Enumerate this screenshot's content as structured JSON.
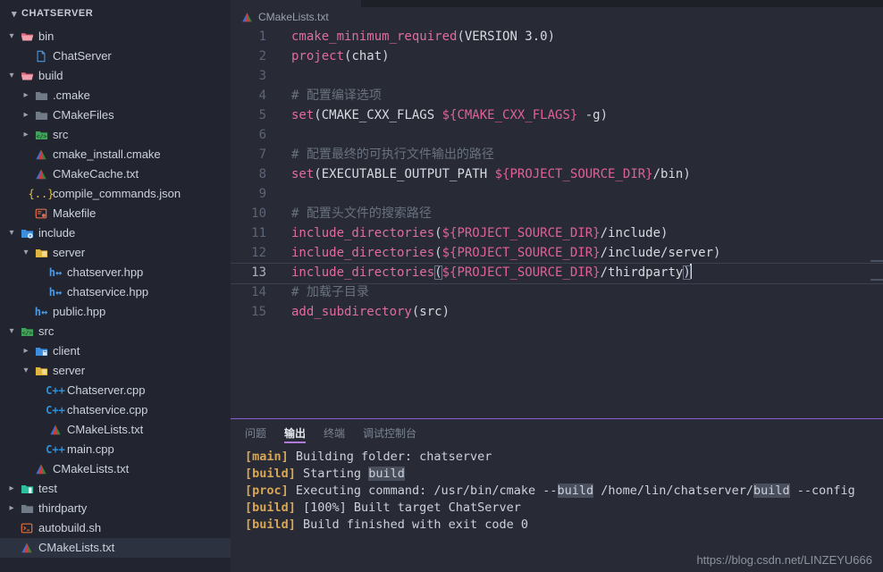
{
  "sidebar": {
    "header": {
      "title": "CHATSERVER",
      "twisty": "chevron-down-icon"
    },
    "items": [
      {
        "label": "bin",
        "indent": 1,
        "twisty": "down",
        "icon": "folder-open-pink",
        "selected": false
      },
      {
        "label": "ChatServer",
        "indent": 2,
        "twisty": "none",
        "icon": "file-blue",
        "selected": false
      },
      {
        "label": "build",
        "indent": 1,
        "twisty": "down",
        "icon": "folder-open-pink",
        "selected": false
      },
      {
        "label": ".cmake",
        "indent": 2,
        "twisty": "right",
        "icon": "folder-grey",
        "selected": false
      },
      {
        "label": "CMakeFiles",
        "indent": 2,
        "twisty": "right",
        "icon": "folder-grey",
        "selected": false
      },
      {
        "label": "src",
        "indent": 2,
        "twisty": "right",
        "icon": "folder-green-code",
        "selected": false
      },
      {
        "label": "cmake_install.cmake",
        "indent": 2,
        "twisty": "none",
        "icon": "cmake-triangle",
        "selected": false
      },
      {
        "label": "CMakeCache.txt",
        "indent": 2,
        "twisty": "none",
        "icon": "cmake-triangle",
        "selected": false
      },
      {
        "label": "compile_commands.json",
        "indent": 2,
        "twisty": "none",
        "icon": "json-braces",
        "selected": false
      },
      {
        "label": "Makefile",
        "indent": 2,
        "twisty": "none",
        "icon": "makefile-red",
        "selected": false
      },
      {
        "label": "include",
        "indent": 1,
        "twisty": "down",
        "icon": "folder-blue-gear",
        "selected": false
      },
      {
        "label": "server",
        "indent": 2,
        "twisty": "down",
        "icon": "folder-yellow",
        "selected": false
      },
      {
        "label": "chatserver.hpp",
        "indent": 3,
        "twisty": "none",
        "icon": "hpp-blue",
        "selected": false
      },
      {
        "label": "chatservice.hpp",
        "indent": 3,
        "twisty": "none",
        "icon": "hpp-blue",
        "selected": false
      },
      {
        "label": "public.hpp",
        "indent": 2,
        "twisty": "none",
        "icon": "hpp-blue",
        "selected": false
      },
      {
        "label": "src",
        "indent": 1,
        "twisty": "down",
        "icon": "folder-green-code",
        "selected": false
      },
      {
        "label": "client",
        "indent": 2,
        "twisty": "right",
        "icon": "folder-blue-win",
        "selected": false
      },
      {
        "label": "server",
        "indent": 2,
        "twisty": "down",
        "icon": "folder-yellow",
        "selected": false
      },
      {
        "label": "Chatserver.cpp",
        "indent": 3,
        "twisty": "none",
        "icon": "cpp-blue",
        "selected": false
      },
      {
        "label": "chatservice.cpp",
        "indent": 3,
        "twisty": "none",
        "icon": "cpp-blue",
        "selected": false
      },
      {
        "label": "CMakeLists.txt",
        "indent": 3,
        "twisty": "none",
        "icon": "cmake-triangle",
        "selected": false
      },
      {
        "label": "main.cpp",
        "indent": 3,
        "twisty": "none",
        "icon": "cpp-blue",
        "selected": false
      },
      {
        "label": "CMakeLists.txt",
        "indent": 2,
        "twisty": "none",
        "icon": "cmake-triangle",
        "selected": false
      },
      {
        "label": "test",
        "indent": 1,
        "twisty": "right",
        "icon": "folder-teal",
        "selected": false
      },
      {
        "label": "thirdparty",
        "indent": 1,
        "twisty": "right",
        "icon": "folder-grey",
        "selected": false
      },
      {
        "label": "autobuild.sh",
        "indent": 1,
        "twisty": "none",
        "icon": "shell-orange",
        "selected": false
      },
      {
        "label": "CMakeLists.txt",
        "indent": 1,
        "twisty": "none",
        "icon": "cmake-triangle",
        "selected": true
      }
    ]
  },
  "editor": {
    "tab": {
      "label": "CMakeLists.txt",
      "icon": "cmake-triangle"
    },
    "breadcrumb": {
      "label": "CMakeLists.txt",
      "icon": "cmake-triangle"
    },
    "current_line": 13,
    "lines": [
      {
        "n": "1",
        "tokens": [
          {
            "t": "cmake_minimum_required",
            "c": "fn"
          },
          {
            "t": "(",
            "c": "punc"
          },
          {
            "t": "VERSION 3.0",
            "c": "arg"
          },
          {
            "t": ")",
            "c": "punc"
          }
        ]
      },
      {
        "n": "2",
        "tokens": [
          {
            "t": "project",
            "c": "fn"
          },
          {
            "t": "(",
            "c": "punc"
          },
          {
            "t": "chat",
            "c": "arg"
          },
          {
            "t": ")",
            "c": "punc"
          }
        ]
      },
      {
        "n": "3",
        "tokens": []
      },
      {
        "n": "4",
        "tokens": [
          {
            "t": "# 配置编译选项",
            "c": "com"
          }
        ]
      },
      {
        "n": "5",
        "tokens": [
          {
            "t": "set",
            "c": "fn"
          },
          {
            "t": "(",
            "c": "punc"
          },
          {
            "t": "CMAKE_CXX_FLAGS ",
            "c": "arg"
          },
          {
            "t": "${CMAKE_CXX_FLAGS}",
            "c": "var"
          },
          {
            "t": " -g",
            "c": "arg"
          },
          {
            "t": ")",
            "c": "punc"
          }
        ]
      },
      {
        "n": "6",
        "tokens": []
      },
      {
        "n": "7",
        "tokens": [
          {
            "t": "# 配置最终的可执行文件输出的路径",
            "c": "com"
          }
        ]
      },
      {
        "n": "8",
        "tokens": [
          {
            "t": "set",
            "c": "fn"
          },
          {
            "t": "(",
            "c": "punc"
          },
          {
            "t": "EXECUTABLE_OUTPUT_PATH ",
            "c": "arg"
          },
          {
            "t": "${PROJECT_SOURCE_DIR}",
            "c": "var"
          },
          {
            "t": "/bin",
            "c": "arg"
          },
          {
            "t": ")",
            "c": "punc"
          }
        ]
      },
      {
        "n": "9",
        "tokens": []
      },
      {
        "n": "10",
        "tokens": [
          {
            "t": "# 配置头文件的搜索路径",
            "c": "com"
          }
        ]
      },
      {
        "n": "11",
        "tokens": [
          {
            "t": "include_directories",
            "c": "fn"
          },
          {
            "t": "(",
            "c": "punc"
          },
          {
            "t": "${PROJECT_SOURCE_DIR}",
            "c": "var"
          },
          {
            "t": "/include",
            "c": "arg"
          },
          {
            "t": ")",
            "c": "punc"
          }
        ]
      },
      {
        "n": "12",
        "tokens": [
          {
            "t": "include_directories",
            "c": "fn"
          },
          {
            "t": "(",
            "c": "punc"
          },
          {
            "t": "${PROJECT_SOURCE_DIR}",
            "c": "var"
          },
          {
            "t": "/include/server",
            "c": "arg"
          },
          {
            "t": ")",
            "c": "punc"
          }
        ]
      },
      {
        "n": "13",
        "tokens": [
          {
            "t": "include_directories",
            "c": "fn"
          },
          {
            "t": "(",
            "c": "punc",
            "bracket": true
          },
          {
            "t": "${PROJECT_SOURCE_DIR}",
            "c": "var"
          },
          {
            "t": "/thirdparty",
            "c": "arg"
          },
          {
            "t": ")",
            "c": "punc",
            "bracket": true
          },
          {
            "t": "",
            "c": "caret"
          }
        ]
      },
      {
        "n": "14",
        "tokens": [
          {
            "t": "# 加载子目录",
            "c": "com"
          }
        ]
      },
      {
        "n": "15",
        "tokens": [
          {
            "t": "add_subdirectory",
            "c": "fn"
          },
          {
            "t": "(",
            "c": "punc"
          },
          {
            "t": "src",
            "c": "arg"
          },
          {
            "t": ")",
            "c": "punc"
          }
        ]
      }
    ]
  },
  "panel": {
    "tabs": [
      {
        "label": "问题",
        "active": false
      },
      {
        "label": "输出",
        "active": true
      },
      {
        "label": "终端",
        "active": false
      },
      {
        "label": "调试控制台",
        "active": false
      }
    ],
    "output": [
      {
        "tag": "[main]",
        "parts": [
          {
            "t": " Building folder: chatserver",
            "hl": false
          }
        ]
      },
      {
        "tag": "[build]",
        "parts": [
          {
            "t": " Starting ",
            "hl": false
          },
          {
            "t": "build",
            "hl": true
          }
        ]
      },
      {
        "tag": "[proc]",
        "parts": [
          {
            "t": " Executing command: /usr/bin/cmake --",
            "hl": false
          },
          {
            "t": "build",
            "hl": true
          },
          {
            "t": " /home/lin/chatserver/",
            "hl": false
          },
          {
            "t": "build",
            "hl": true
          },
          {
            "t": " --config",
            "hl": false
          }
        ]
      },
      {
        "tag": "[build]",
        "parts": [
          {
            "t": " [100%] Built target ChatServer",
            "hl": false
          }
        ]
      },
      {
        "tag": "[build]",
        "parts": [
          {
            "t": " Build finished with exit code 0",
            "hl": false
          }
        ]
      }
    ]
  },
  "watermark": {
    "text": "https://blog.csdn.net/LINZEYU666"
  },
  "colors": {
    "sidebar_bg": "#22252f",
    "editor_bg": "#282b35",
    "panel_border": "#8a5fd1",
    "selection_bg": "#2d3240",
    "function_pink": "#e06c9f",
    "variable_pink": "#e0609a",
    "comment_grey": "#69717f",
    "text_grey": "#d7dae0",
    "output_tag_gold": "#d8a657",
    "match_highlight": "#4a4f5e"
  }
}
